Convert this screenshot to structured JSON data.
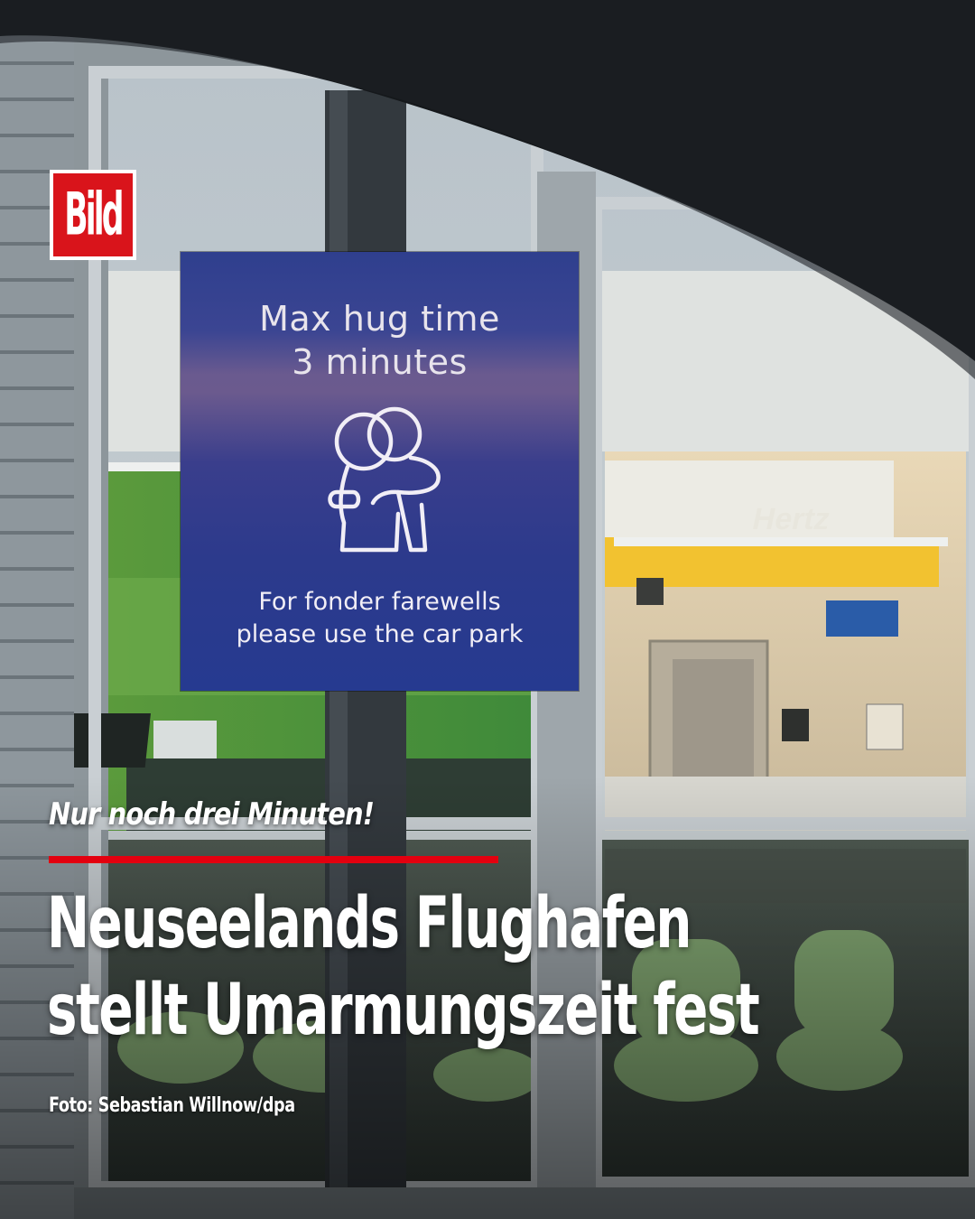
{
  "brand": {
    "logo_text": "Bild"
  },
  "sign": {
    "title_line1": "Max hug time",
    "title_line2": "3 minutes",
    "icon": "hug-icon",
    "footer_line1": "For fonder farewells",
    "footer_line2": "please use the car park"
  },
  "background": {
    "shop_sign": "Hertz"
  },
  "overlay": {
    "kicker": "Nur noch drei Minuten!",
    "headline_line1": "Neuseelands Flughafen",
    "headline_line2": "stellt Umarmungszeit fest",
    "credit": "Foto: Sebastian Willnow/dpa"
  },
  "colors": {
    "accent_red": "#e3000f",
    "sign_blue": "#2c3a8c"
  }
}
